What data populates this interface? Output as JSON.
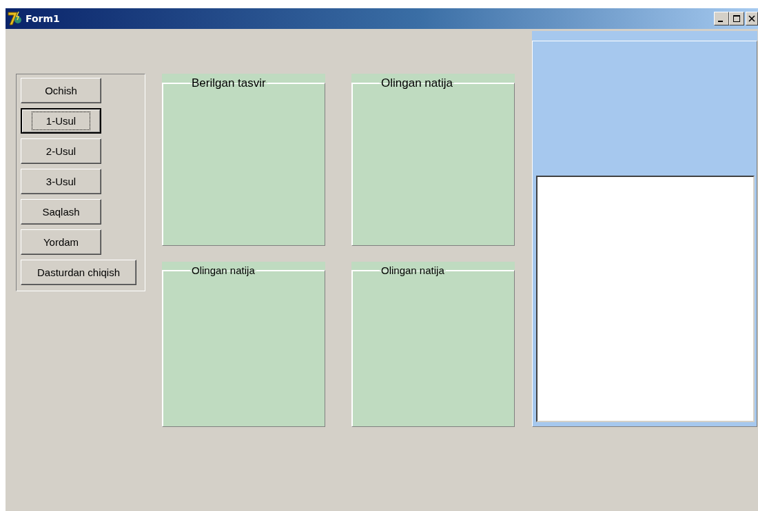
{
  "window": {
    "title": "Form1"
  },
  "buttons": [
    {
      "label": "Ochish",
      "focused": false
    },
    {
      "label": "1-Usul",
      "focused": true
    },
    {
      "label": "2-Usul",
      "focused": false
    },
    {
      "label": "3-Usul",
      "focused": false
    },
    {
      "label": "Saqlash",
      "focused": false
    },
    {
      "label": "Yordam",
      "focused": false
    },
    {
      "label": "Dasturdan chiqish",
      "focused": false
    }
  ],
  "image_groups": [
    {
      "title": "Berilgan tasvir"
    },
    {
      "title": "Olingan natija"
    },
    {
      "title": "Olingan natija"
    },
    {
      "title": "Olingan natija"
    }
  ]
}
